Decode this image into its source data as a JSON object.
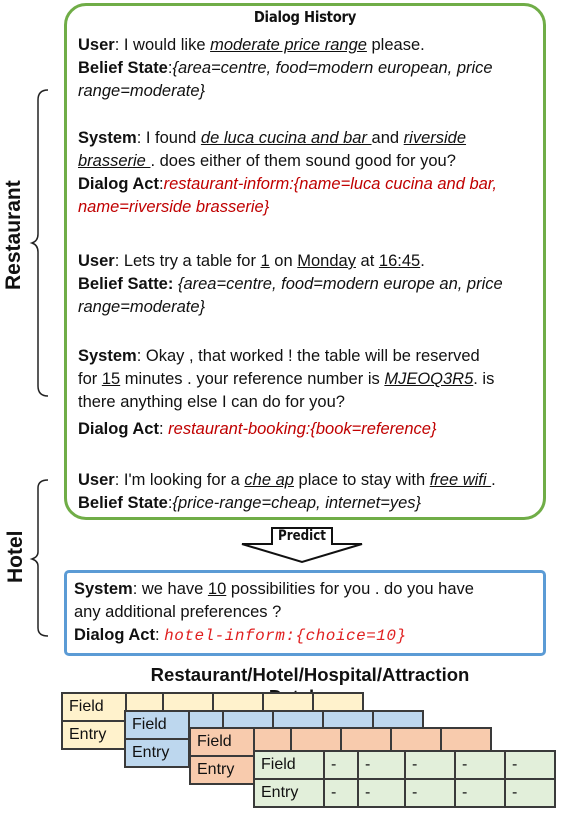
{
  "history": {
    "title": "Dialog History",
    "turns": [
      {
        "speaker": "User",
        "pre": ": I would like ",
        "slot": "moderate price range",
        "post": " please."
      },
      {
        "label": "Belief State",
        "sep": ":",
        "value_line1": "{area=centre, food=modern european, price",
        "value_line2": "range=moderate}"
      },
      {
        "speaker": "System",
        "pre": ": I found ",
        "slot1": "de luca cucina and bar ",
        "mid": "and ",
        "slot2": "riverside",
        "line2_slot": "brasserie ",
        "line2_post": ". does either of them sound good for you?"
      },
      {
        "label": "Dialog Act",
        "sep": ":",
        "value_line1": "restaurant-inform:{name=luca cucina and bar,",
        "value_line2": "name=riverside brasserie}"
      },
      {
        "speaker": "User",
        "pre": ": Lets try a table for ",
        "slot1": "1",
        "mid1": " on ",
        "slot2": "Monday",
        "mid2": " at ",
        "slot3": "16:45",
        "post": "."
      },
      {
        "label": "Belief Satte:",
        "sep": " ",
        "value_line1": "{area=centre, food=modern europe an, price",
        "value_line2": "range=moderate}"
      },
      {
        "speaker": "System",
        "pre": ": Okay , that worked ! the table will be reserved",
        "line2_pre": "for ",
        "line2_slot1": "15",
        "line2_mid": " minutes  . your reference number is ",
        "line2_slot2": "MJEOQ3R5",
        "line2_post": ". is",
        "line3": "there anything else I can do for you?"
      },
      {
        "label": "Dialog Act",
        "sep": ": ",
        "value_line1": "restaurant-booking:{book=reference}"
      },
      {
        "speaker": "User",
        "pre": ":  I'm looking  for a ",
        "slot1": "che ap",
        "mid": " place to stay with ",
        "slot2": "free wifi ",
        "post": "."
      },
      {
        "label": "Belief State",
        "sep": ":",
        "value_line1": "{price-range=cheap, internet=yes}"
      }
    ]
  },
  "side_labels": {
    "restaurant": "Restaurant",
    "hotel": "Hotel"
  },
  "predict_label": "Predict",
  "prediction": {
    "speaker": "System",
    "pre": ": we have ",
    "slot": "10",
    "post": " possibilities  for you . do you  have",
    "line2": "any additional  preferences ?",
    "act_label": "Dialog Act",
    "act_sep": ":   ",
    "act_value": "hotel-inform:{choice=10}"
  },
  "database": {
    "title_line1": "Restaurant/Hotel/Hospital/Attraction",
    "title_line2": "Database",
    "tables": [
      {
        "color": "#fff2cc",
        "rows": [
          [
            "Field",
            "",
            "",
            "",
            "",
            ""
          ],
          [
            "Entry",
            "",
            "",
            "",
            "",
            ""
          ]
        ]
      },
      {
        "color": "#bdd7ee",
        "rows": [
          [
            "Field",
            "",
            "",
            "",
            "",
            ""
          ],
          [
            "Entry",
            "",
            "",
            "",
            "",
            ""
          ]
        ]
      },
      {
        "color": "#f8cbad",
        "rows": [
          [
            "Field",
            "",
            "",
            "",
            "",
            ""
          ],
          [
            "Entry",
            "",
            "",
            "",
            "",
            ""
          ]
        ]
      },
      {
        "color": "#e2efda",
        "rows": [
          [
            "Field",
            "-",
            "-",
            "-",
            "-",
            "-"
          ],
          [
            "Entry",
            "-",
            "-",
            "-",
            "-",
            "-"
          ]
        ]
      }
    ]
  },
  "colors": {
    "history_border": "#70ad47",
    "prediction_border": "#5b9bd5",
    "dialog_act": "#c00000"
  }
}
